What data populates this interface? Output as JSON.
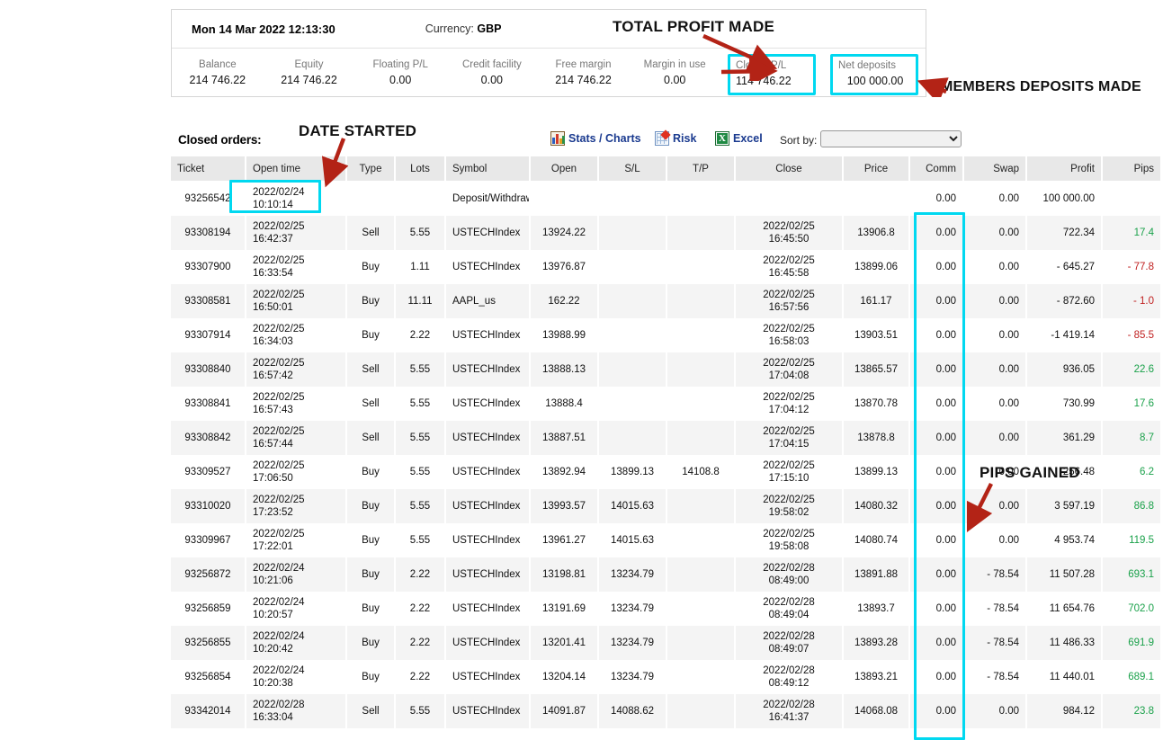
{
  "account": {
    "datetime": "Mon 14 Mar 2022 12:13:30",
    "currency_label": "Currency:",
    "currency_value": "GBP",
    "stats": [
      {
        "label": "Balance",
        "value": "214 746.22"
      },
      {
        "label": "Equity",
        "value": "214 746.22"
      },
      {
        "label": "Floating P/L",
        "value": "0.00"
      },
      {
        "label": "Credit facility",
        "value": "0.00"
      },
      {
        "label": "Free margin",
        "value": "214 746.22"
      },
      {
        "label": "Margin in use",
        "value": "0.00"
      }
    ],
    "closed_pl": {
      "label": "Closed P/L",
      "value": "114 746.22"
    },
    "net_deposits": {
      "label": "Net deposits",
      "value": "100 000.00"
    }
  },
  "toolbar": {
    "title": "Closed orders:",
    "stats_charts": "Stats / Charts",
    "risk": "Risk",
    "excel": "Excel",
    "sort_by_label": "Sort by:",
    "sort_by_value": "",
    "sort_by_options": [
      ""
    ]
  },
  "table": {
    "columns": [
      "Ticket",
      "Open time",
      "Type",
      "Lots",
      "Symbol",
      "Open",
      "S/L",
      "T/P",
      "Close",
      "Price",
      "Comm",
      "Swap",
      "Profit",
      "Pips"
    ],
    "rows": [
      {
        "ticket": "93256542",
        "open_date": "2022/02/24",
        "open_time": "10:10:14",
        "type": "",
        "lots": "",
        "symbol": "Deposit/Withdrawal",
        "open": "",
        "sl": "",
        "tp": "",
        "close_date": "",
        "close_time": "",
        "price": "",
        "comm": "0.00",
        "swap": "0.00",
        "profit": "100 000.00",
        "pips": "",
        "pips_sign": "none"
      },
      {
        "ticket": "93308194",
        "open_date": "2022/02/25",
        "open_time": "16:42:37",
        "type": "Sell",
        "lots": "5.55",
        "symbol": "USTECHIndex",
        "open": "13924.22",
        "sl": "",
        "tp": "",
        "close_date": "2022/02/25",
        "close_time": "16:45:50",
        "price": "13906.8",
        "comm": "0.00",
        "swap": "0.00",
        "profit": "722.34",
        "pips": "17.4",
        "pips_sign": "pos"
      },
      {
        "ticket": "93307900",
        "open_date": "2022/02/25",
        "open_time": "16:33:54",
        "type": "Buy",
        "lots": "1.11",
        "symbol": "USTECHIndex",
        "open": "13976.87",
        "sl": "",
        "tp": "",
        "close_date": "2022/02/25",
        "close_time": "16:45:58",
        "price": "13899.06",
        "comm": "0.00",
        "swap": "0.00",
        "profit": "- 645.27",
        "pips": "- 77.8",
        "pips_sign": "neg"
      },
      {
        "ticket": "93308581",
        "open_date": "2022/02/25",
        "open_time": "16:50:01",
        "type": "Buy",
        "lots": "11.11",
        "symbol": "AAPL_us",
        "open": "162.22",
        "sl": "",
        "tp": "",
        "close_date": "2022/02/25",
        "close_time": "16:57:56",
        "price": "161.17",
        "comm": "0.00",
        "swap": "0.00",
        "profit": "- 872.60",
        "pips": "- 1.0",
        "pips_sign": "neg"
      },
      {
        "ticket": "93307914",
        "open_date": "2022/02/25",
        "open_time": "16:34:03",
        "type": "Buy",
        "lots": "2.22",
        "symbol": "USTECHIndex",
        "open": "13988.99",
        "sl": "",
        "tp": "",
        "close_date": "2022/02/25",
        "close_time": "16:58:03",
        "price": "13903.51",
        "comm": "0.00",
        "swap": "0.00",
        "profit": "-1 419.14",
        "pips": "- 85.5",
        "pips_sign": "neg"
      },
      {
        "ticket": "93308840",
        "open_date": "2022/02/25",
        "open_time": "16:57:42",
        "type": "Sell",
        "lots": "5.55",
        "symbol": "USTECHIndex",
        "open": "13888.13",
        "sl": "",
        "tp": "",
        "close_date": "2022/02/25",
        "close_time": "17:04:08",
        "price": "13865.57",
        "comm": "0.00",
        "swap": "0.00",
        "profit": "936.05",
        "pips": "22.6",
        "pips_sign": "pos"
      },
      {
        "ticket": "93308841",
        "open_date": "2022/02/25",
        "open_time": "16:57:43",
        "type": "Sell",
        "lots": "5.55",
        "symbol": "USTECHIndex",
        "open": "13888.4",
        "sl": "",
        "tp": "",
        "close_date": "2022/02/25",
        "close_time": "17:04:12",
        "price": "13870.78",
        "comm": "0.00",
        "swap": "0.00",
        "profit": "730.99",
        "pips": "17.6",
        "pips_sign": "pos"
      },
      {
        "ticket": "93308842",
        "open_date": "2022/02/25",
        "open_time": "16:57:44",
        "type": "Sell",
        "lots": "5.55",
        "symbol": "USTECHIndex",
        "open": "13887.51",
        "sl": "",
        "tp": "",
        "close_date": "2022/02/25",
        "close_time": "17:04:15",
        "price": "13878.8",
        "comm": "0.00",
        "swap": "0.00",
        "profit": "361.29",
        "pips": "8.7",
        "pips_sign": "pos"
      },
      {
        "ticket": "93309527",
        "open_date": "2022/02/25",
        "open_time": "17:06:50",
        "type": "Buy",
        "lots": "5.55",
        "symbol": "USTECHIndex",
        "open": "13892.94",
        "sl": "13899.13",
        "tp": "14108.8",
        "close_date": "2022/02/25",
        "close_time": "17:15:10",
        "price": "13899.13",
        "comm": "0.00",
        "swap": "0.00",
        "profit": "256.48",
        "pips": "6.2",
        "pips_sign": "pos"
      },
      {
        "ticket": "93310020",
        "open_date": "2022/02/25",
        "open_time": "17:23:52",
        "type": "Buy",
        "lots": "5.55",
        "symbol": "USTECHIndex",
        "open": "13993.57",
        "sl": "14015.63",
        "tp": "",
        "close_date": "2022/02/25",
        "close_time": "19:58:02",
        "price": "14080.32",
        "comm": "0.00",
        "swap": "0.00",
        "profit": "3 597.19",
        "pips": "86.8",
        "pips_sign": "pos"
      },
      {
        "ticket": "93309967",
        "open_date": "2022/02/25",
        "open_time": "17:22:01",
        "type": "Buy",
        "lots": "5.55",
        "symbol": "USTECHIndex",
        "open": "13961.27",
        "sl": "14015.63",
        "tp": "",
        "close_date": "2022/02/25",
        "close_time": "19:58:08",
        "price": "14080.74",
        "comm": "0.00",
        "swap": "0.00",
        "profit": "4 953.74",
        "pips": "119.5",
        "pips_sign": "pos"
      },
      {
        "ticket": "93256872",
        "open_date": "2022/02/24",
        "open_time": "10:21:06",
        "type": "Buy",
        "lots": "2.22",
        "symbol": "USTECHIndex",
        "open": "13198.81",
        "sl": "13234.79",
        "tp": "",
        "close_date": "2022/02/28",
        "close_time": "08:49:00",
        "price": "13891.88",
        "comm": "0.00",
        "swap": "- 78.54",
        "profit": "11 507.28",
        "pips": "693.1",
        "pips_sign": "pos"
      },
      {
        "ticket": "93256859",
        "open_date": "2022/02/24",
        "open_time": "10:20:57",
        "type": "Buy",
        "lots": "2.22",
        "symbol": "USTECHIndex",
        "open": "13191.69",
        "sl": "13234.79",
        "tp": "",
        "close_date": "2022/02/28",
        "close_time": "08:49:04",
        "price": "13893.7",
        "comm": "0.00",
        "swap": "- 78.54",
        "profit": "11 654.76",
        "pips": "702.0",
        "pips_sign": "pos"
      },
      {
        "ticket": "93256855",
        "open_date": "2022/02/24",
        "open_time": "10:20:42",
        "type": "Buy",
        "lots": "2.22",
        "symbol": "USTECHIndex",
        "open": "13201.41",
        "sl": "13234.79",
        "tp": "",
        "close_date": "2022/02/28",
        "close_time": "08:49:07",
        "price": "13893.28",
        "comm": "0.00",
        "swap": "- 78.54",
        "profit": "11 486.33",
        "pips": "691.9",
        "pips_sign": "pos"
      },
      {
        "ticket": "93256854",
        "open_date": "2022/02/24",
        "open_time": "10:20:38",
        "type": "Buy",
        "lots": "2.22",
        "symbol": "USTECHIndex",
        "open": "13204.14",
        "sl": "13234.79",
        "tp": "",
        "close_date": "2022/02/28",
        "close_time": "08:49:12",
        "price": "13893.21",
        "comm": "0.00",
        "swap": "- 78.54",
        "profit": "11 440.01",
        "pips": "689.1",
        "pips_sign": "pos"
      },
      {
        "ticket": "93342014",
        "open_date": "2022/02/28",
        "open_time": "16:33:04",
        "type": "Sell",
        "lots": "5.55",
        "symbol": "USTECHIndex",
        "open": "14091.87",
        "sl": "14088.62",
        "tp": "",
        "close_date": "2022/02/28",
        "close_time": "16:41:37",
        "price": "14068.08",
        "comm": "0.00",
        "swap": "0.00",
        "profit": "984.12",
        "pips": "23.8",
        "pips_sign": "pos"
      }
    ]
  },
  "annotations": {
    "total_profit": "TOTAL PROFIT MADE",
    "members_deposits": "MEMBERS DEPOSITS MADE",
    "date_started": "DATE STARTED",
    "pips_gained": "PIPS GAINED"
  },
  "colors": {
    "highlight_box": "#00d8f0",
    "arrow_red": "#b32316",
    "profit_green": "#1aa14a",
    "loss_red": "#c02020",
    "link_blue": "#1a3a8f"
  }
}
